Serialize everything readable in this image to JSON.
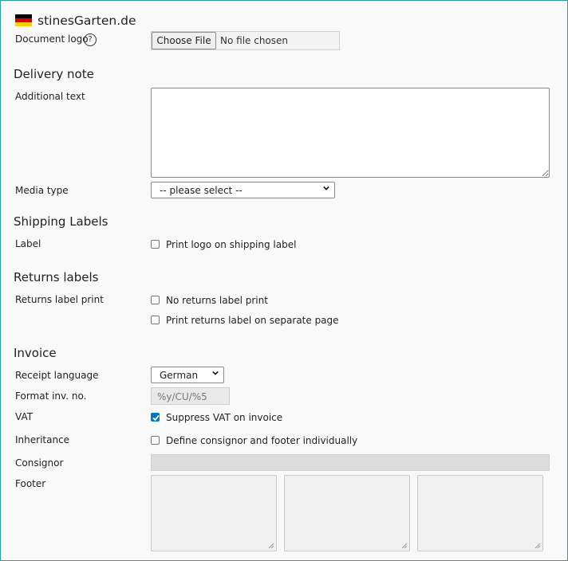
{
  "header": {
    "shop_name": "stinesGarten.de",
    "flag_icon": "germany-flag-icon"
  },
  "document_logo": {
    "label": "Document logo",
    "choose_file_label": "Choose File",
    "file_status": "No file chosen",
    "help_glyph": "?"
  },
  "delivery_note": {
    "heading": "Delivery note",
    "additional_text_label": "Additional text",
    "additional_text_value": "",
    "media_type_label": "Media type",
    "media_type_value": "-- please select --"
  },
  "shipping_labels": {
    "heading": "Shipping Labels",
    "label_label": "Label",
    "print_logo_label": "Print logo on shipping label",
    "print_logo_checked": false
  },
  "returns_labels": {
    "heading": "Returns labels",
    "print_label": "Returns label print",
    "no_returns_label": "No returns label print",
    "no_returns_checked": false,
    "separate_page_label": "Print returns label on separate page",
    "separate_page_checked": false
  },
  "invoice": {
    "heading": "Invoice",
    "receipt_language_label": "Receipt language",
    "receipt_language_value": "German",
    "format_inv_no_label": "Format inv. no.",
    "format_inv_no_placeholder": "%y/CU/%5",
    "vat_label": "VAT",
    "suppress_vat_label": "Suppress VAT on invoice",
    "suppress_vat_checked": true,
    "inheritance_label": "Inheritance",
    "define_individually_label": "Define consignor and footer individually",
    "define_individually_checked": false,
    "consignor_label": "Consignor",
    "consignor_value": "",
    "footer_label": "Footer"
  },
  "colors": {
    "frame_border": "#2aa198",
    "checkbox_checked": "#0075c9"
  }
}
